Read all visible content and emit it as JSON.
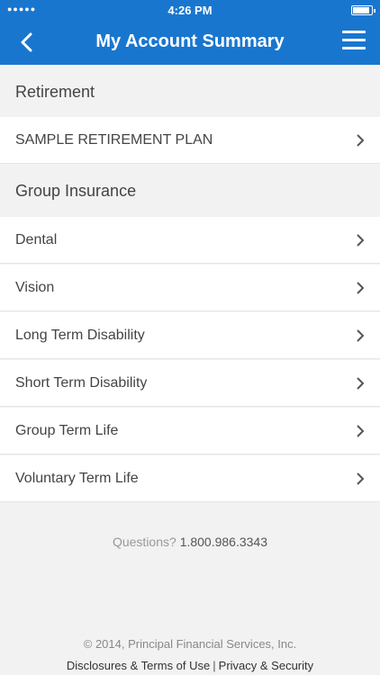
{
  "status_bar": {
    "signal": "●●●●●",
    "time": "4:26 PM"
  },
  "nav": {
    "title": "My Account Summary"
  },
  "sections": [
    {
      "header": "Retirement",
      "items": [
        {
          "label": "SAMPLE RETIREMENT PLAN"
        }
      ]
    },
    {
      "header": "Group Insurance",
      "items": [
        {
          "label": "Dental"
        },
        {
          "label": "Vision"
        },
        {
          "label": "Long Term Disability"
        },
        {
          "label": "Short Term Disability"
        },
        {
          "label": "Group Term Life"
        },
        {
          "label": "Voluntary Term Life"
        }
      ]
    }
  ],
  "footer": {
    "questions_label": "Questions?",
    "phone": "1.800.986.3343",
    "copyright": "© 2014, Principal Financial Services, Inc.",
    "disclosures_link": "Disclosures & Terms of Use",
    "separator": "|",
    "privacy_link": "Privacy & Security"
  }
}
